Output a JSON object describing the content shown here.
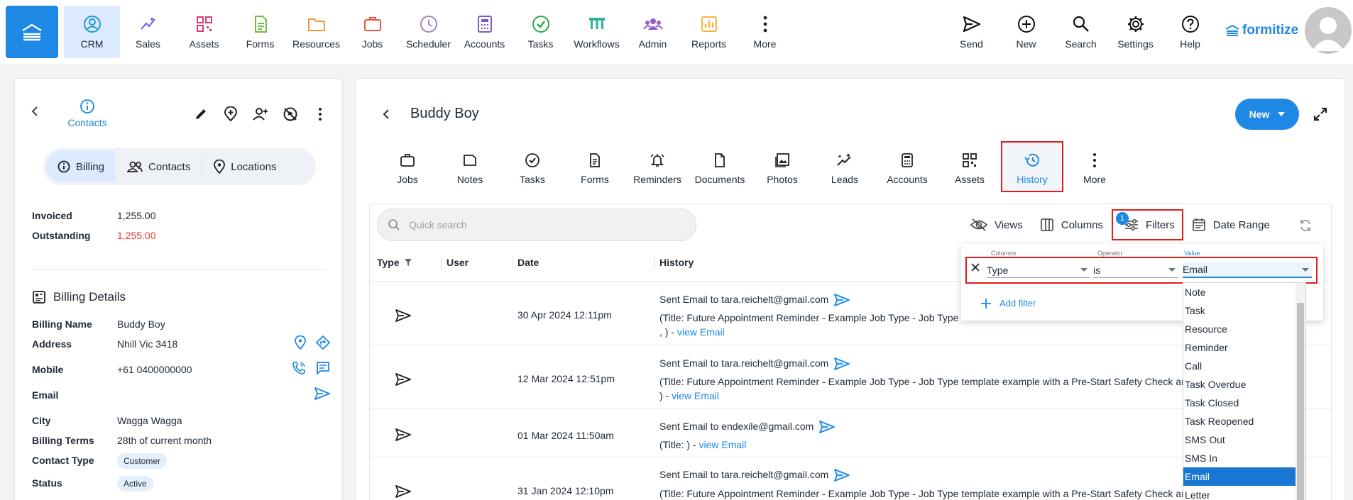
{
  "nav": {
    "items": [
      {
        "label": "CRM",
        "icon": "crm-icon"
      },
      {
        "label": "Sales",
        "icon": "sales-icon"
      },
      {
        "label": "Assets",
        "icon": "assets-icon"
      },
      {
        "label": "Forms",
        "icon": "forms-icon"
      },
      {
        "label": "Resources",
        "icon": "resources-icon"
      },
      {
        "label": "Jobs",
        "icon": "jobs-icon"
      },
      {
        "label": "Scheduler",
        "icon": "scheduler-icon"
      },
      {
        "label": "Accounts",
        "icon": "accounts-icon"
      },
      {
        "label": "Tasks",
        "icon": "tasks-icon"
      },
      {
        "label": "Workflows",
        "icon": "workflows-icon"
      },
      {
        "label": "Admin",
        "icon": "admin-icon"
      },
      {
        "label": "Reports",
        "icon": "reports-icon"
      },
      {
        "label": "More",
        "icon": "more-icon"
      }
    ],
    "right": [
      {
        "label": "Send",
        "icon": "send-icon"
      },
      {
        "label": "New",
        "icon": "plus-circle-icon"
      },
      {
        "label": "Search",
        "icon": "search-icon"
      },
      {
        "label": "Settings",
        "icon": "gear-icon"
      },
      {
        "label": "Help",
        "icon": "help-icon"
      }
    ],
    "brand": "formitize"
  },
  "contact": {
    "back_label": "Contacts",
    "segments": [
      "Billing",
      "Contacts",
      "Locations"
    ],
    "invoiced_label": "Invoiced",
    "invoiced": "1,255.00",
    "outstanding_label": "Outstanding",
    "outstanding": "1,255.00",
    "billing_title": "Billing Details",
    "fields": {
      "billing_name_label": "Billing Name",
      "billing_name": "Buddy Boy",
      "address_label": "Address",
      "address": "Nhill Vic 3418",
      "mobile_label": "Mobile",
      "mobile": "+61 0400000000",
      "email_label": "Email",
      "city_label": "City",
      "city": "Wagga Wagga",
      "terms_label": "Billing Terms",
      "terms": "28th of current month",
      "contact_type_label": "Contact Type",
      "contact_type": "Customer",
      "status_label": "Status",
      "status": "Active"
    }
  },
  "record": {
    "title": "Buddy Boy",
    "new_label": "New",
    "tabs": [
      "Jobs",
      "Notes",
      "Tasks",
      "Forms",
      "Reminders",
      "Documents",
      "Photos",
      "Leads",
      "Accounts",
      "Assets",
      "History",
      "More"
    ],
    "active_tab": "History"
  },
  "toolbar": {
    "search_placeholder": "Quick search",
    "views": "Views",
    "columns": "Columns",
    "filters": "Filters",
    "filter_count": "1",
    "date_range": "Date Range"
  },
  "table": {
    "headers": [
      "Type",
      "User",
      "Date",
      "History"
    ],
    "rows": [
      {
        "date": "30 Apr 2024 12:11pm",
        "line1": "Sent Email to tara.reichelt@gmail.com",
        "line2": "(Title: Future Appointment Reminder - Example Job Type - Job Type",
        "line3": ", ) - ",
        "link": "view Email"
      },
      {
        "date": "12 Mar 2024 12:51pm",
        "line1": "Sent Email to tara.reichelt@gmail.com",
        "line2": "(Title: Future Appointment Reminder - Example Job Type - Job Type template example with a Pre-Start Safety Check ar",
        "line3": ") - ",
        "link": "view Email"
      },
      {
        "date": "01 Mar 2024 11:50am",
        "line1": "Sent Email to endexile@gmail.com",
        "line2": "(Title: ) - ",
        "line3": "",
        "link": "view Email"
      },
      {
        "date": "31 Jan 2024 12:10pm",
        "line1": "Sent Email to tara.reichelt@gmail.com",
        "line2": "(Title: Future Appointment Reminder - Example Job Type - Job Type template example with a Pre-Start Safety Check ar",
        "line3": "",
        "link": ""
      }
    ]
  },
  "filter": {
    "labels": {
      "columns": "Columns",
      "operator": "Operator",
      "value": "Value"
    },
    "column": "Type",
    "operator": "is",
    "value": "Email",
    "add_label": "Add filter",
    "options": [
      "Note",
      "Task",
      "Resource",
      "Reminder",
      "Call",
      "Task Overdue",
      "Task Closed",
      "Task Reopened",
      "SMS Out",
      "SMS In",
      "Email",
      "Letter"
    ],
    "selected": "Email"
  },
  "colors": {
    "accent": "#1e88e5",
    "highlight": "#e41b1b",
    "negative": "#e53935"
  }
}
